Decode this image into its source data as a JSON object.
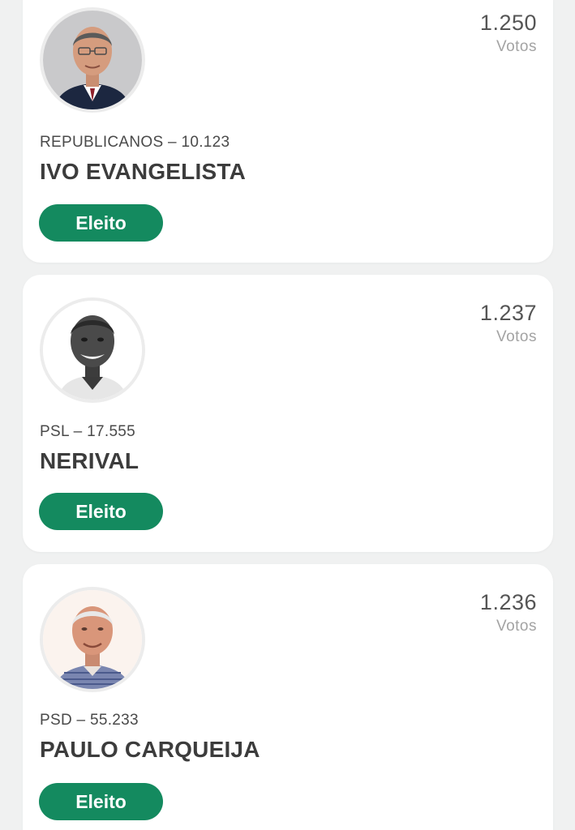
{
  "candidates": [
    {
      "votes": "1.250",
      "votes_label": "Votos",
      "party_line": "REPUBLICANOS – 10.123",
      "name": "IVO EVANGELISTA",
      "status": "Eleito",
      "photo": "candidate-portrait"
    },
    {
      "votes": "1.237",
      "votes_label": "Votos",
      "party_line": "PSL – 17.555",
      "name": "NERIVAL",
      "status": "Eleito",
      "photo": "candidate-portrait"
    },
    {
      "votes": "1.236",
      "votes_label": "Votos",
      "party_line": "PSD – 55.233",
      "name": "PAULO CARQUEIJA",
      "status": "Eleito",
      "photo": "candidate-portrait"
    }
  ],
  "colors": {
    "badge_background": "#148a5f",
    "page_background": "#f0f1f1",
    "card_background": "#ffffff"
  }
}
